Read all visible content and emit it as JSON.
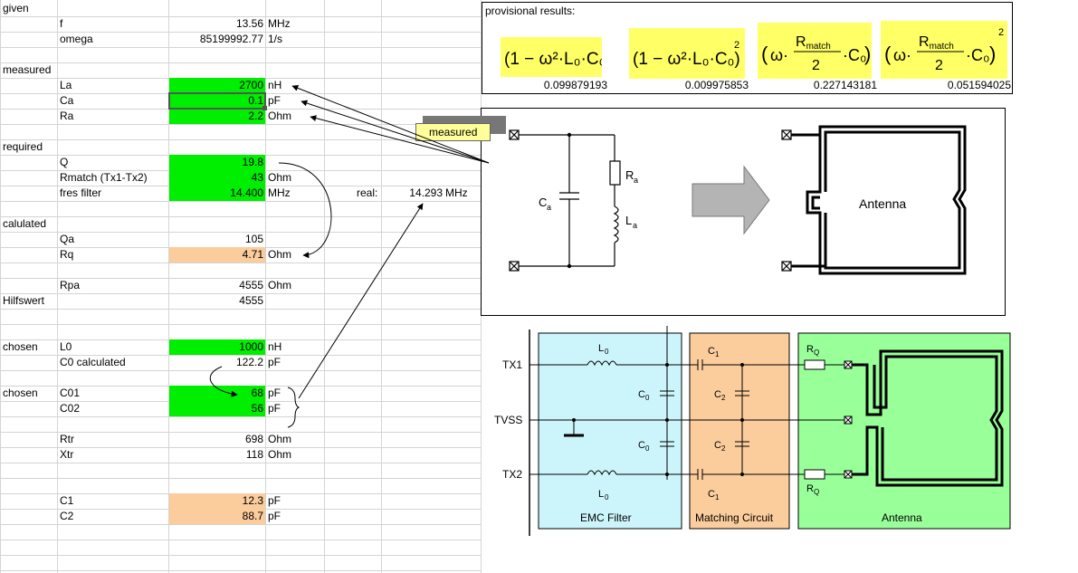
{
  "sections": {
    "given": "given",
    "measured": "measured",
    "required": "required",
    "calulated": "calulated",
    "hilfswert": "Hilfswert",
    "chosen1": "chosen",
    "chosen2": "chosen"
  },
  "rows": {
    "f": {
      "label": "f",
      "value": "13.56",
      "unit": "MHz"
    },
    "omega": {
      "label": "omega",
      "value": "85199992.77",
      "unit": "1/s"
    },
    "La": {
      "label": "La",
      "value": "2700",
      "unit": "nH"
    },
    "Ca": {
      "label": "Ca",
      "value": "0.1",
      "unit": "pF"
    },
    "Ra": {
      "label": "Ra",
      "value": "2.2",
      "unit": "Ohm"
    },
    "Q": {
      "label": "Q",
      "value": "19.8",
      "unit": ""
    },
    "Rmatch": {
      "label": "Rmatch (Tx1-Tx2)",
      "value": "43",
      "unit": "Ohm"
    },
    "fres": {
      "label": "fres filter",
      "value": "14.400",
      "unit": "MHz",
      "real_label": "real:",
      "real_value": "14.293",
      "real_unit": "MHz"
    },
    "Qa": {
      "label": "Qa",
      "value": "105",
      "unit": ""
    },
    "Rq": {
      "label": "Rq",
      "value": "4.71",
      "unit": "Ohm"
    },
    "Rpa": {
      "label": "Rpa",
      "value": "4555",
      "unit": "Ohm"
    },
    "Hilfswert": {
      "label": "",
      "value": "4555",
      "unit": ""
    },
    "L0": {
      "label": "L0",
      "value": "1000",
      "unit": "nH"
    },
    "C0calc": {
      "label": "C0 calculated",
      "value": "122.2",
      "unit": "pF"
    },
    "C01": {
      "label": "C01",
      "value": "68",
      "unit": "pF"
    },
    "C02": {
      "label": "C02",
      "value": "56",
      "unit": "pF"
    },
    "Rtr": {
      "label": "Rtr",
      "value": "698",
      "unit": "Ohm"
    },
    "Xtr": {
      "label": "Xtr",
      "value": "118",
      "unit": "Ohm"
    },
    "C1": {
      "label": "C1",
      "value": "12.3",
      "unit": "pF"
    },
    "C2": {
      "label": "C2",
      "value": "88.7",
      "unit": "pF"
    }
  },
  "provisional": {
    "title": "provisional results:",
    "values": [
      "0.099879193",
      "0.009975853",
      "0.227143181",
      "0.051594025"
    ]
  },
  "callout": "measured",
  "antenna_diagram": {
    "ca": "C",
    "ca_sub": "a",
    "ra": "R",
    "ra_sub": "a",
    "la": "L",
    "la_sub": "a",
    "antenna": "Antenna"
  },
  "circuit": {
    "tx1": "TX1",
    "tvss": "TVSS",
    "tx2": "TX2",
    "emc": "EMC Filter",
    "matching": "Matching Circuit",
    "antenna": "Antenna",
    "l0": "L",
    "c0": "C",
    "c1": "C",
    "c2": "C",
    "rq": "R",
    "sub_0": "0",
    "sub_1": "1",
    "sub_2": "2",
    "sub_q": "Q"
  },
  "colors": {
    "input_green": "#00ee00",
    "result_peach": "#fbcc9c",
    "formula_yellow": "#ffff66",
    "emc_blue": "#ccf5fb",
    "matching_orange": "#fbcc9c",
    "antenna_green": "#99ff99"
  }
}
